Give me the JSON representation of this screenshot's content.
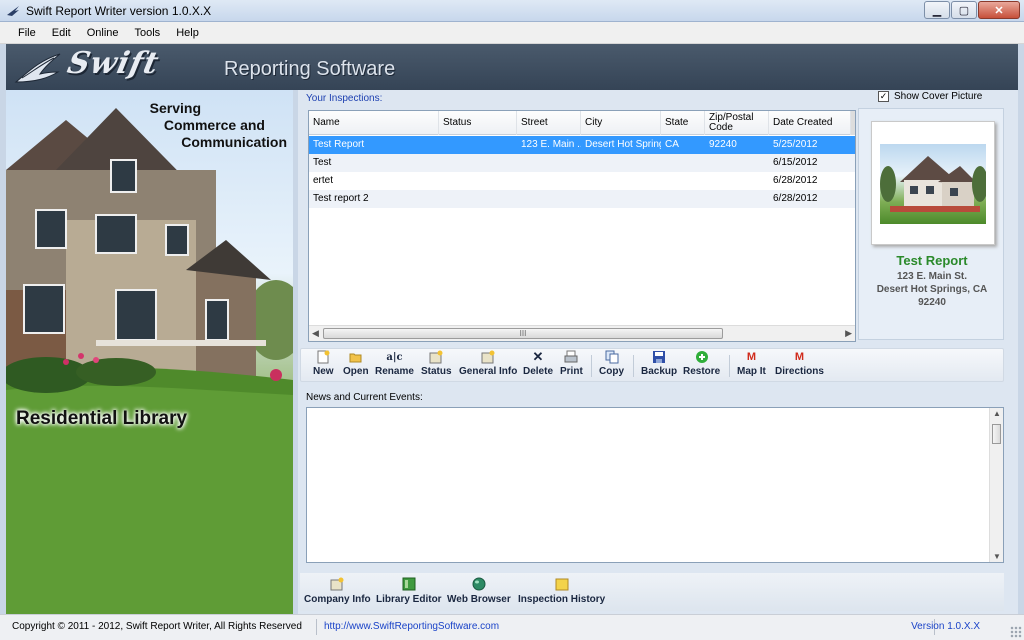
{
  "window": {
    "title": "Swift Report Writer version 1.0.X.X",
    "buttons": [
      "minimize",
      "maximize",
      "close"
    ]
  },
  "menu": [
    {
      "label": "File"
    },
    {
      "label": "Edit"
    },
    {
      "label": "Online"
    },
    {
      "label": "Tools"
    },
    {
      "label": "Help"
    }
  ],
  "banner": {
    "logo": "Swift",
    "tagline": "Reporting Software"
  },
  "hero": {
    "serving_lines": [
      "Serving",
      "Commerce and",
      "Communication"
    ],
    "library": "Residential Library"
  },
  "inspections": {
    "label": "Your Inspections:",
    "columns": [
      "Name",
      "Status",
      "Street",
      "City",
      "State",
      "Zip/Postal Code",
      "Date Created"
    ],
    "rows": [
      {
        "name": "Test Report",
        "status": "",
        "street": "123 E. Main ...",
        "city": "Desert Hot Springs",
        "state": "CA",
        "zip": "92240",
        "date": "5/25/2012",
        "selected": true
      },
      {
        "name": "Test",
        "status": "",
        "street": "",
        "city": "",
        "state": "",
        "zip": "",
        "date": "6/15/2012",
        "selected": false
      },
      {
        "name": "ertet",
        "status": "",
        "street": "",
        "city": "",
        "state": "",
        "zip": "",
        "date": "6/28/2012",
        "selected": false
      },
      {
        "name": "Test report 2",
        "status": "",
        "street": "",
        "city": "",
        "state": "",
        "zip": "",
        "date": "6/28/2012",
        "selected": false
      }
    ],
    "scroll_thumb_label": "III"
  },
  "cover": {
    "show_label": "Show Cover Picture",
    "checked": true,
    "title": "Test Report",
    "address1": "123 E. Main St.",
    "address2": "Desert Hot Springs, CA",
    "zip": "92240"
  },
  "toolbar": {
    "new": "New",
    "open": "Open",
    "rename": "Rename",
    "status": "Status",
    "general_info": "General Info",
    "delete": "Delete",
    "print": "Print",
    "copy": "Copy",
    "backup": "Backup",
    "restore": "Restore",
    "map_it": "Map It",
    "directions": "Directions"
  },
  "news": {
    "label": "News and Current Events:"
  },
  "bottom": {
    "company_info": "Company Info",
    "library_editor": "Library Editor",
    "web_browser": "Web Browser",
    "inspection_history": "Inspection History"
  },
  "status": {
    "copyright": "Copyright © 2011 - 2012, Swift Report Writer, All Rights Reserved",
    "url": "http://www.SwiftReportingSoftware.com",
    "version": "Version 1.0.X.X"
  },
  "colors": {
    "selection": "#3399ff",
    "link": "#1a43c8",
    "cover_title": "#2b8a2b"
  }
}
